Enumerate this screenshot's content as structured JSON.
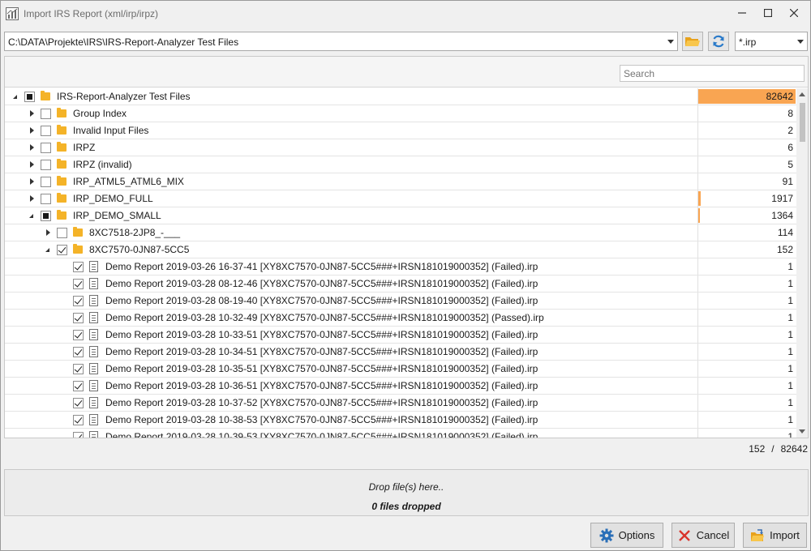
{
  "window": {
    "title": "Import IRS Report (xml/irp/irpz)"
  },
  "toolbar": {
    "path_value": "C:\\DATA\\Projekte\\IRS\\IRS-Report-Analyzer Test Files",
    "filter_value": "*.irp"
  },
  "search": {
    "placeholder": "Search"
  },
  "colors": {
    "accent": "#f9a552",
    "folder": "#f4b328"
  },
  "icons": {
    "app": "report-chart-icon",
    "folder_button": "folder-open-icon",
    "refresh_button": "refresh-icon",
    "options": "gear-icon",
    "cancel": "close-icon",
    "import": "import-folder-icon"
  },
  "tree": {
    "rows": [
      {
        "level": 0,
        "expander": "expanded",
        "check": "partial",
        "icon": "folder",
        "label": "IRS-Report-Analyzer Test Files",
        "count": "82642",
        "fill": 1.0
      },
      {
        "level": 1,
        "expander": "collapsed",
        "check": "unchecked",
        "icon": "folder",
        "label": "Group Index",
        "count": "8",
        "fill": 0
      },
      {
        "level": 1,
        "expander": "collapsed",
        "check": "unchecked",
        "icon": "folder",
        "label": "Invalid Input Files",
        "count": "2",
        "fill": 0
      },
      {
        "level": 1,
        "expander": "collapsed",
        "check": "unchecked",
        "icon": "folder",
        "label": "IRPZ",
        "count": "6",
        "fill": 0
      },
      {
        "level": 1,
        "expander": "collapsed",
        "check": "unchecked",
        "icon": "folder",
        "label": "IRPZ (invalid)",
        "count": "5",
        "fill": 0
      },
      {
        "level": 1,
        "expander": "collapsed",
        "check": "unchecked",
        "icon": "folder",
        "label": "IRP_ATML5_ATML6_MIX",
        "count": "91",
        "fill": 0
      },
      {
        "level": 1,
        "expander": "collapsed",
        "check": "unchecked",
        "icon": "folder",
        "label": "IRP_DEMO_FULL",
        "count": "1917",
        "fill": 0.023
      },
      {
        "level": 1,
        "expander": "expanded",
        "check": "partial",
        "icon": "folder",
        "label": "IRP_DEMO_SMALL",
        "count": "1364",
        "fill": 0.017
      },
      {
        "level": 2,
        "expander": "collapsed",
        "check": "unchecked",
        "icon": "folder",
        "label": "8XC7518-2JP8_-___",
        "count": "114",
        "fill": 0
      },
      {
        "level": 2,
        "expander": "expanded",
        "check": "checked",
        "icon": "folder",
        "label": "8XC7570-0JN87-5CC5",
        "count": "152",
        "fill": 0
      },
      {
        "level": 3,
        "expander": "none",
        "check": "checked",
        "icon": "file",
        "label": "Demo Report 2019-03-26 16-37-41 [XY8XC7570-0JN87-5CC5###+IRSN181019000352] (Failed).irp",
        "count": "1",
        "fill": 0
      },
      {
        "level": 3,
        "expander": "none",
        "check": "checked",
        "icon": "file",
        "label": "Demo Report 2019-03-28 08-12-46 [XY8XC7570-0JN87-5CC5###+IRSN181019000352] (Failed).irp",
        "count": "1",
        "fill": 0
      },
      {
        "level": 3,
        "expander": "none",
        "check": "checked",
        "icon": "file",
        "label": "Demo Report 2019-03-28 08-19-40 [XY8XC7570-0JN87-5CC5###+IRSN181019000352] (Failed).irp",
        "count": "1",
        "fill": 0
      },
      {
        "level": 3,
        "expander": "none",
        "check": "checked",
        "icon": "file",
        "label": "Demo Report 2019-03-28 10-32-49 [XY8XC7570-0JN87-5CC5###+IRSN181019000352] (Passed).irp",
        "count": "1",
        "fill": 0
      },
      {
        "level": 3,
        "expander": "none",
        "check": "checked",
        "icon": "file",
        "label": "Demo Report 2019-03-28 10-33-51 [XY8XC7570-0JN87-5CC5###+IRSN181019000352] (Failed).irp",
        "count": "1",
        "fill": 0
      },
      {
        "level": 3,
        "expander": "none",
        "check": "checked",
        "icon": "file",
        "label": "Demo Report 2019-03-28 10-34-51 [XY8XC7570-0JN87-5CC5###+IRSN181019000352] (Failed).irp",
        "count": "1",
        "fill": 0
      },
      {
        "level": 3,
        "expander": "none",
        "check": "checked",
        "icon": "file",
        "label": "Demo Report 2019-03-28 10-35-51 [XY8XC7570-0JN87-5CC5###+IRSN181019000352] (Failed).irp",
        "count": "1",
        "fill": 0
      },
      {
        "level": 3,
        "expander": "none",
        "check": "checked",
        "icon": "file",
        "label": "Demo Report 2019-03-28 10-36-51 [XY8XC7570-0JN87-5CC5###+IRSN181019000352] (Failed).irp",
        "count": "1",
        "fill": 0
      },
      {
        "level": 3,
        "expander": "none",
        "check": "checked",
        "icon": "file",
        "label": "Demo Report 2019-03-28 10-37-52 [XY8XC7570-0JN87-5CC5###+IRSN181019000352] (Failed).irp",
        "count": "1",
        "fill": 0
      },
      {
        "level": 3,
        "expander": "none",
        "check": "checked",
        "icon": "file",
        "label": "Demo Report 2019-03-28 10-38-53 [XY8XC7570-0JN87-5CC5###+IRSN181019000352] (Failed).irp",
        "count": "1",
        "fill": 0
      },
      {
        "level": 3,
        "expander": "none",
        "check": "checked",
        "icon": "file",
        "label": "Demo Report 2019-03-28 10-39-53 [XY8XC7570-0JN87-5CC5###+IRSN181019000352] (Failed).irp",
        "count": "1",
        "fill": 0
      }
    ]
  },
  "summary": {
    "selected": "152",
    "separator": "/",
    "total": "82642"
  },
  "dropzone": {
    "hint": "Drop file(s) here..",
    "count_text": "0 files dropped"
  },
  "buttons": {
    "options_label": "Options",
    "cancel_label": "Cancel",
    "import_label": "Import"
  }
}
